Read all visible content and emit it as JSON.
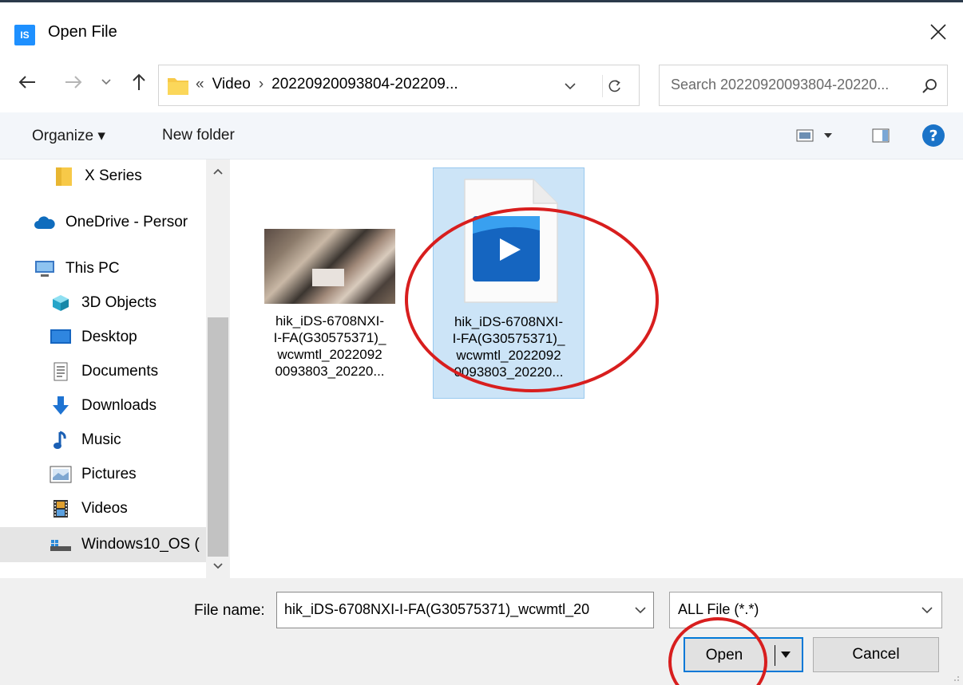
{
  "window": {
    "title": "Open File",
    "app_icon_text": "IS",
    "close_glyph": "✕"
  },
  "nav": {
    "address_segments": [
      "«",
      "Video",
      "›",
      "20220920093804-202209..."
    ],
    "search_placeholder": "Search 20220920093804-20220..."
  },
  "toolbar": {
    "organize_label": "Organize ▾",
    "new_folder_label": "New folder"
  },
  "sidebar": {
    "items": [
      {
        "label": "X Series",
        "icon": "folder-icon"
      },
      {
        "label": "OneDrive - Persor",
        "icon": "cloud-icon"
      },
      {
        "label": "This PC",
        "icon": "computer-icon"
      },
      {
        "label": "3D Objects",
        "icon": "cube-icon"
      },
      {
        "label": "Desktop",
        "icon": "desktop-icon"
      },
      {
        "label": "Documents",
        "icon": "documents-icon"
      },
      {
        "label": "Downloads",
        "icon": "download-arrow-icon"
      },
      {
        "label": "Music",
        "icon": "music-note-icon"
      },
      {
        "label": "Pictures",
        "icon": "pictures-icon"
      },
      {
        "label": "Videos",
        "icon": "film-icon"
      },
      {
        "label": "Windows10_OS (",
        "icon": "drive-icon"
      }
    ]
  },
  "files": [
    {
      "lines": [
        "hik_iDS-6708NXI-",
        "I-FA(G30575371)_",
        "wcwmtl_2022092",
        "0093803_20220..."
      ],
      "kind": "video-thumbnail",
      "selected": false
    },
    {
      "lines": [
        "hik_iDS-6708NXI-",
        "I-FA(G30575371)_",
        "wcwmtl_2022092",
        "0093803_20220..."
      ],
      "kind": "video-file-icon",
      "selected": true
    }
  ],
  "bottom": {
    "file_name_label": "File name:",
    "file_name_value": "hik_iDS-6708NXI-I-FA(G30575371)_wcwmtl_20",
    "file_type_value": "ALL File (*.*)",
    "open_label": "Open",
    "cancel_label": "Cancel"
  },
  "colors": {
    "accent": "#0078d7",
    "selection": "#cce4f7",
    "annotation": "#d81e1e",
    "help": "#1a73c8"
  }
}
